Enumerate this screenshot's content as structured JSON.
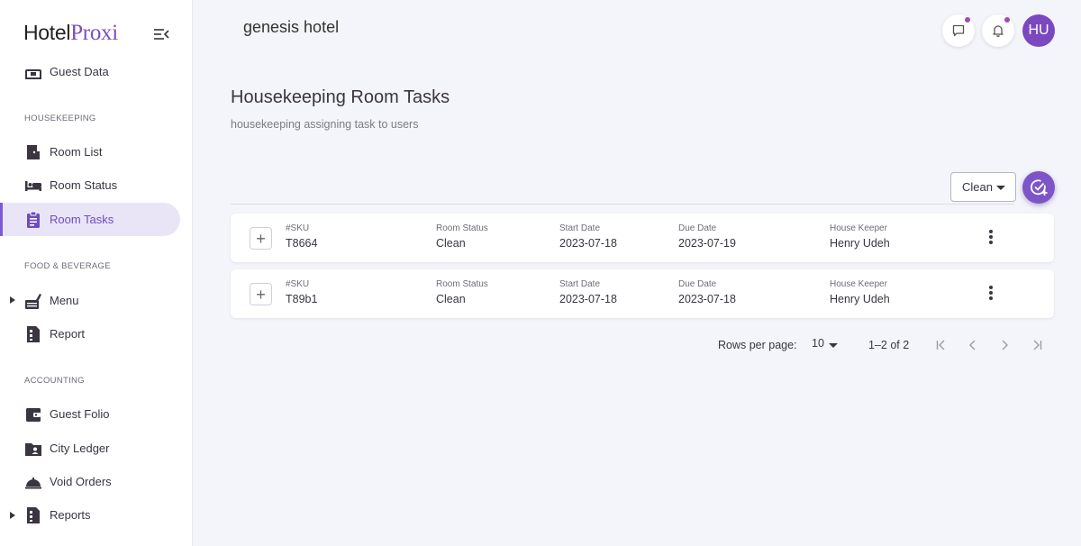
{
  "brand": {
    "name_part1": "Hotel",
    "name_part2": "Proxi"
  },
  "sidebar": {
    "partial_item": {
      "label": "Guest Data",
      "icon": "guest-data-icon"
    },
    "sections": [
      {
        "label": "HOUSEKEEPING"
      },
      {
        "label": "FOOD & BEVERAGE"
      },
      {
        "label": "ACCOUNTING"
      }
    ],
    "items": [
      {
        "label": "Room List",
        "icon": "door-icon"
      },
      {
        "label": "Room Status",
        "icon": "bed-icon"
      },
      {
        "label": "Room Tasks",
        "icon": "clipboard-icon",
        "active": true
      },
      {
        "label": "Menu",
        "icon": "food-tray-icon",
        "expandable": true
      },
      {
        "label": "Report",
        "icon": "report-icon"
      },
      {
        "label": "Guest Folio",
        "icon": "wallet-icon"
      },
      {
        "label": "City Ledger",
        "icon": "folder-account-icon"
      },
      {
        "label": "Void Orders",
        "icon": "room-service-icon"
      },
      {
        "label": "Reports",
        "icon": "report-icon",
        "expandable": true
      }
    ]
  },
  "header": {
    "hotel_name": "genesis hotel",
    "avatar_initials": "HU",
    "notification_dot_color": "#a24bb2"
  },
  "page": {
    "title": "Housekeeping Room Tasks",
    "subtitle": "housekeeping assigning task to users",
    "filter_value": "Clean"
  },
  "columns": {
    "sku": "#SKU",
    "room_status": "Room Status",
    "start_date": "Start Date",
    "due_date": "Due Date",
    "house_keeper": "House Keeper"
  },
  "tasks": [
    {
      "sku": "T8664",
      "room_status": "Clean",
      "start_date": "2023-07-18",
      "due_date": "2023-07-19",
      "house_keeper": "Henry Udeh"
    },
    {
      "sku": "T89b1",
      "room_status": "Clean",
      "start_date": "2023-07-18",
      "due_date": "2023-07-18",
      "house_keeper": "Henry Udeh"
    }
  ],
  "pagination": {
    "rows_per_page_label": "Rows per page:",
    "rows_per_page": "10",
    "range": "1–2 of 2"
  },
  "colors": {
    "accent": "#7c4dbe",
    "active_bg": "#e9e5f7",
    "page_bg": "#f4f5fa"
  }
}
